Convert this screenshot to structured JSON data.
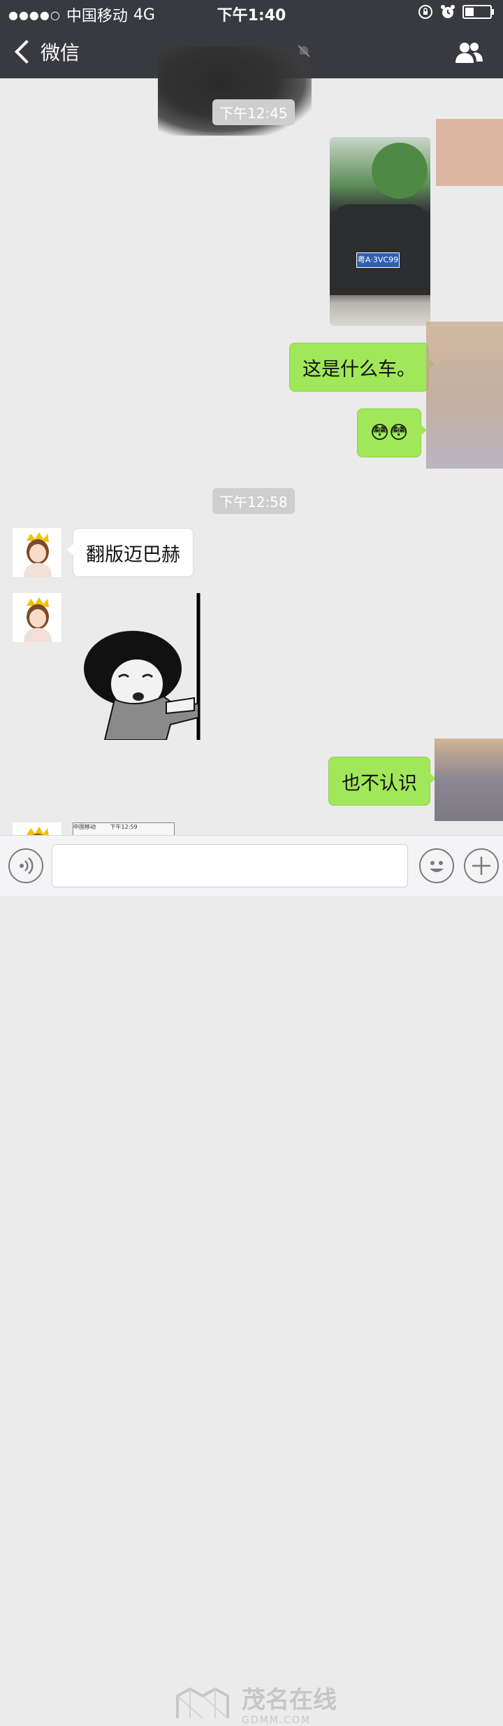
{
  "status_bar": {
    "signal": "●●●●○",
    "carrier": "中国移动",
    "network": "4G",
    "time": "下午1:40",
    "battery_level": 0.35
  },
  "nav": {
    "back_label": "微信",
    "back_icon": "chevron-left-icon",
    "mute_icon": "mute-bell-icon",
    "contacts_icon": "contacts-icon"
  },
  "messages": [
    {
      "type": "timestamp",
      "text": "下午12:45"
    },
    {
      "type": "image",
      "from": "me",
      "plate_text": "粤A·3VC99"
    },
    {
      "type": "text",
      "from": "me",
      "text": "这是什么车。"
    },
    {
      "type": "emoji",
      "from": "me",
      "text": "😳😳"
    },
    {
      "type": "timestamp",
      "text": "下午12:58"
    },
    {
      "type": "text",
      "from": "other",
      "text": "翻版迈巴赫"
    },
    {
      "type": "sticker",
      "from": "other"
    },
    {
      "type": "text",
      "from": "me",
      "text": "也不认识"
    },
    {
      "type": "image",
      "from": "other",
      "thumb_time": "下午12:59",
      "thumb_carrier": "中国移动"
    }
  ],
  "input_bar": {
    "voice_icon": "voice-icon",
    "emoji_icon": "emoji-icon",
    "plus_icon": "plus-icon"
  },
  "watermark": {
    "cn": "茂名在线",
    "en": "GDMM.COM"
  },
  "colors": {
    "header_bg": "#393a3f",
    "chat_bg": "#ebebeb",
    "outgoing_bubble": "#a0e75a",
    "incoming_bubble": "#ffffff"
  }
}
